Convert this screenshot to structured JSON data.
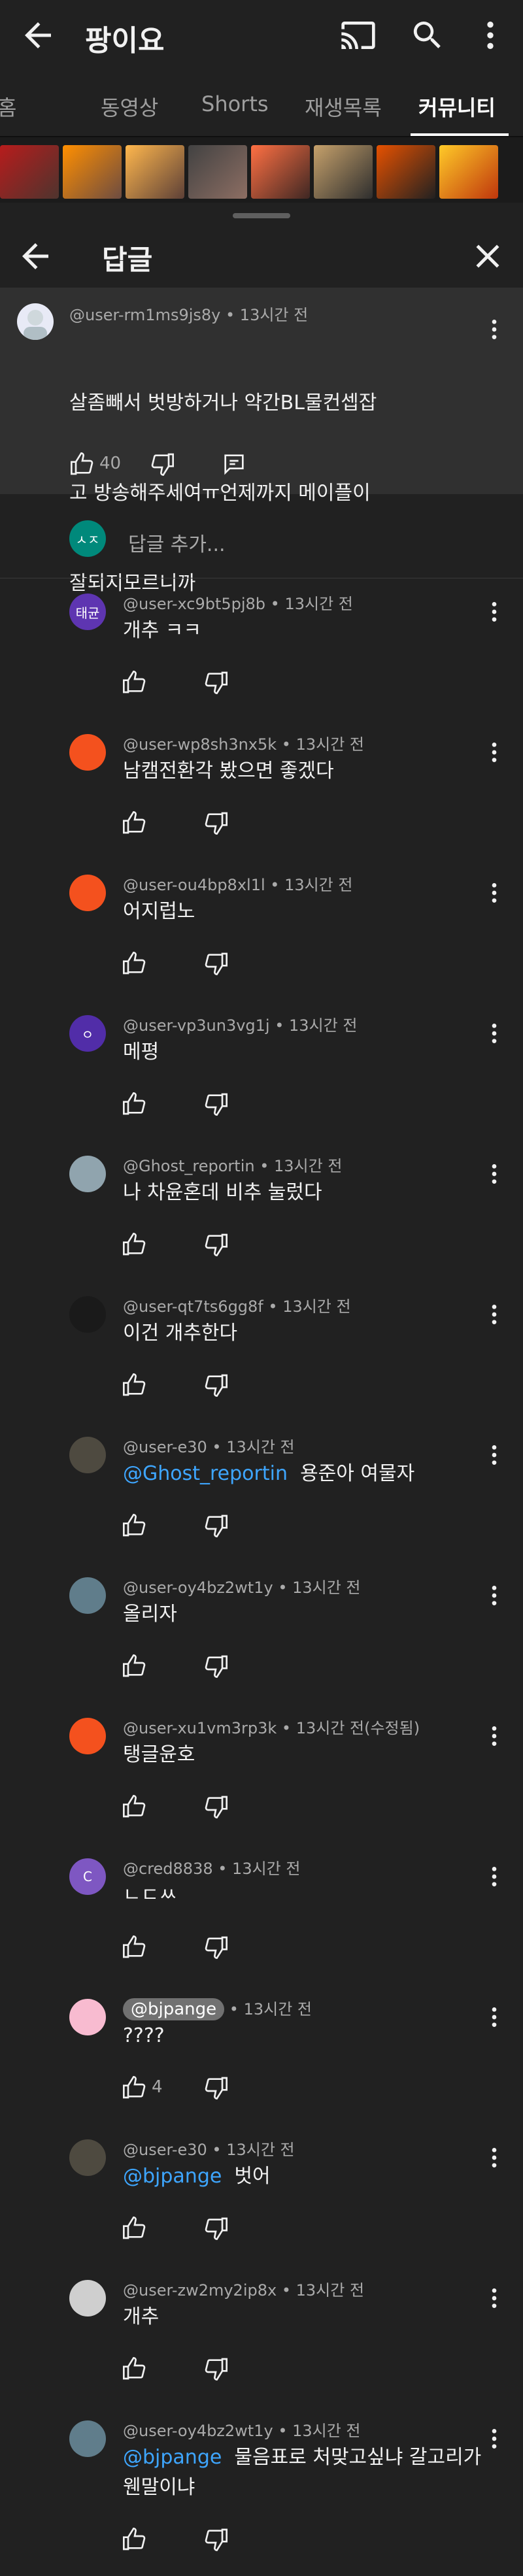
{
  "app": {
    "title": "팡이요"
  },
  "tabs": [
    {
      "label": "홈"
    },
    {
      "label": "동영상"
    },
    {
      "label": "Shorts"
    },
    {
      "label": "재생목록"
    },
    {
      "label": "커뮤니티"
    }
  ],
  "sheet": {
    "title": "답글",
    "add_reply_placeholder": "답글 추가...",
    "input_avatar_text": "ㅅㅈ"
  },
  "parent_comment": {
    "author": "@user-rm1ms9js8y",
    "time": "13시간 전",
    "text": "살좀빼서 벗방하거나 약간BL물컨셉잡고 방송해주세여ㅠ언제까지 메이플이 잘되지모르니까",
    "lines": [
      "살좀빼서 벗방하거나 약간BL물컨셉잡",
      "고 방송해주세여ㅠ언제까지 메이플이",
      "잘되지모르니까"
    ],
    "likes": "40"
  },
  "replies": [
    {
      "author": "@user-xc9bt5pj8b",
      "time": "13시간 전",
      "text": "개추 ㅋㅋ",
      "avatar_text": "태균",
      "avatar_color": "#5e35b1"
    },
    {
      "author": "@user-wp8sh3nx5k",
      "time": "13시간 전",
      "text": "남캠전환각 봤으면 좋겠다",
      "avatar_text": "",
      "avatar_color": "#f4511e"
    },
    {
      "author": "@user-ou4bp8xl1l",
      "time": "13시간 전",
      "text": "어지럽노",
      "avatar_text": "",
      "avatar_color": "#f4511e"
    },
    {
      "author": "@user-vp3un3vg1j",
      "time": "13시간 전",
      "text": "메평",
      "avatar_text": "ㅇ",
      "avatar_color": "#512da8"
    },
    {
      "author": "@Ghost_reportin",
      "time": "13시간 전",
      "text": "나 차윤혼데 비추 눌렀다",
      "avatar_text": "",
      "avatar_color": "#90a4ae"
    },
    {
      "author": "@user-qt7ts6gg8f",
      "time": "13시간 전",
      "text": "이건 개추한다",
      "avatar_text": "",
      "avatar_color": "#1a1a1a"
    },
    {
      "author": "@user-e30",
      "time": "13시간 전",
      "mention": "@Ghost_reportin",
      "text": "용준아 여물자",
      "avatar_text": "",
      "avatar_color": "#4e4a40"
    },
    {
      "author": "@user-oy4bz2wt1y",
      "time": "13시간 전",
      "text": "올리자",
      "avatar_text": "",
      "avatar_color": "#607d8b"
    },
    {
      "author": "@user-xu1vm3rp3k",
      "time": "13시간 전(수정됨)",
      "text": "탱글윤호",
      "avatar_text": "",
      "avatar_color": "#f4511e"
    },
    {
      "author": "@cred8838",
      "time": "13시간 전",
      "text": "ㄴㄷㅆ",
      "avatar_text": "C",
      "avatar_color": "#7e57c2"
    },
    {
      "author": "@bjpange",
      "time": "13시간 전",
      "text": "????",
      "likes": "4",
      "avatar_text": "",
      "avatar_color": "#f8bbd0",
      "author_chip": true
    },
    {
      "author": "@user-e30",
      "time": "13시간 전",
      "mention": "@bjpange",
      "text": "벗어",
      "avatar_text": "",
      "avatar_color": "#4e4a40"
    },
    {
      "author": "@user-zw2my2ip8x",
      "time": "13시간 전",
      "text": "개추",
      "avatar_text": "",
      "avatar_color": "#cfcfcf"
    },
    {
      "author": "@user-oy4bz2wt1y",
      "time": "13시간 전",
      "mention": "@bjpange",
      "text": "물음표로 처맞고싶냐 갈고리가 웬말이냐",
      "lines": [
        "물음표로 처맞고싶냐 갈고리가",
        "웬말이냐"
      ],
      "avatar_text": "",
      "avatar_color": "#607d8b"
    }
  ],
  "colors": {
    "background": "#0f0f0f",
    "sheet": "#212121",
    "highlight": "#303030",
    "mention": "#3ea6ff",
    "text_secondary": "#aaaaaa"
  },
  "icons": [
    "back-arrow-icon",
    "cast-icon",
    "search-icon",
    "more-vert-icon",
    "close-icon",
    "thumb-up-icon",
    "thumb-down-icon",
    "reply-icon"
  ]
}
